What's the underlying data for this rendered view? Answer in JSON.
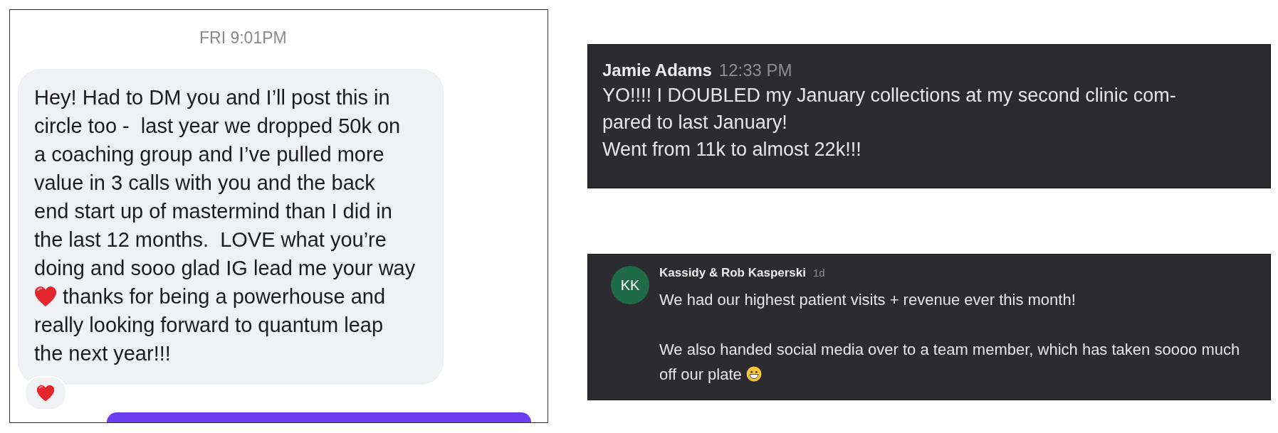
{
  "direct_message": {
    "timestamp": "FRI 9:01PM",
    "text_before_heart": "Hey! Had to DM you and I’ll post this in\ncircle too -  last year we dropped 50k on\na coaching group and I’ve pulled more\nvalue in 3 calls with you and the back\nend start up of mastermind than I did in\nthe last 12 months.  LOVE what you’re\ndoing and sooo glad IG lead me your way\n",
    "text_after_heart": " thanks for being a powerhouse and",
    "text_closing": "really looking forward to quantum leap\nthe next year!!!"
  },
  "posts": [
    {
      "kind": "plain",
      "author": "Jamie Adams",
      "time": "12:33 PM",
      "text": "YO!!!! I DOUBLED my January collections at my second clinic com-\npared to last January!\nWent from 11k to almost 22k!!!"
    },
    {
      "kind": "avatar",
      "author": "Kassidy & Rob Kasperski",
      "time": "1d",
      "initials": "KK",
      "color": "#1f6a47",
      "text": "We had our highest patient visits + revenue ever this month!\n\nWe also handed social media over to a team member, which has taken soooo much\noff our plate "
    }
  ]
}
